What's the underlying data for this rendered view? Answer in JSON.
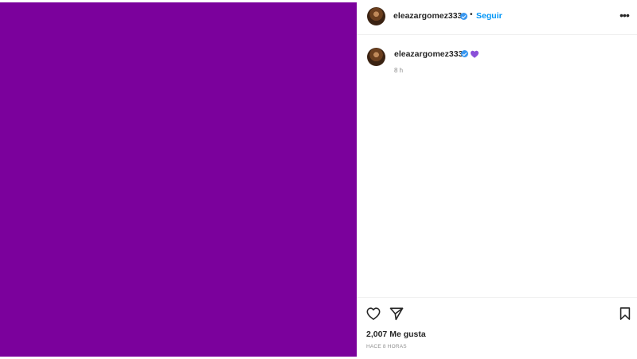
{
  "media": {
    "background_color": "#7b019c"
  },
  "header": {
    "username": "eleazargomez333",
    "verified_icon": "verified-badge-icon",
    "separator": "•",
    "follow_label": "Seguir",
    "more_icon": "more-options-icon"
  },
  "caption": {
    "username": "eleazargomez333",
    "verified_icon": "verified-badge-icon",
    "emoji": "purple-heart-icon",
    "time": "8 h"
  },
  "footer": {
    "like_icon": "heart-outline-icon",
    "share_icon": "paper-plane-icon",
    "save_icon": "bookmark-icon",
    "likes_text": "2,007 Me gusta",
    "posted_ago": "HACE 8 HORAS"
  },
  "colors": {
    "accent": "#0095f6",
    "verified": "#3897f0",
    "emoji": "#8a4fd8"
  }
}
